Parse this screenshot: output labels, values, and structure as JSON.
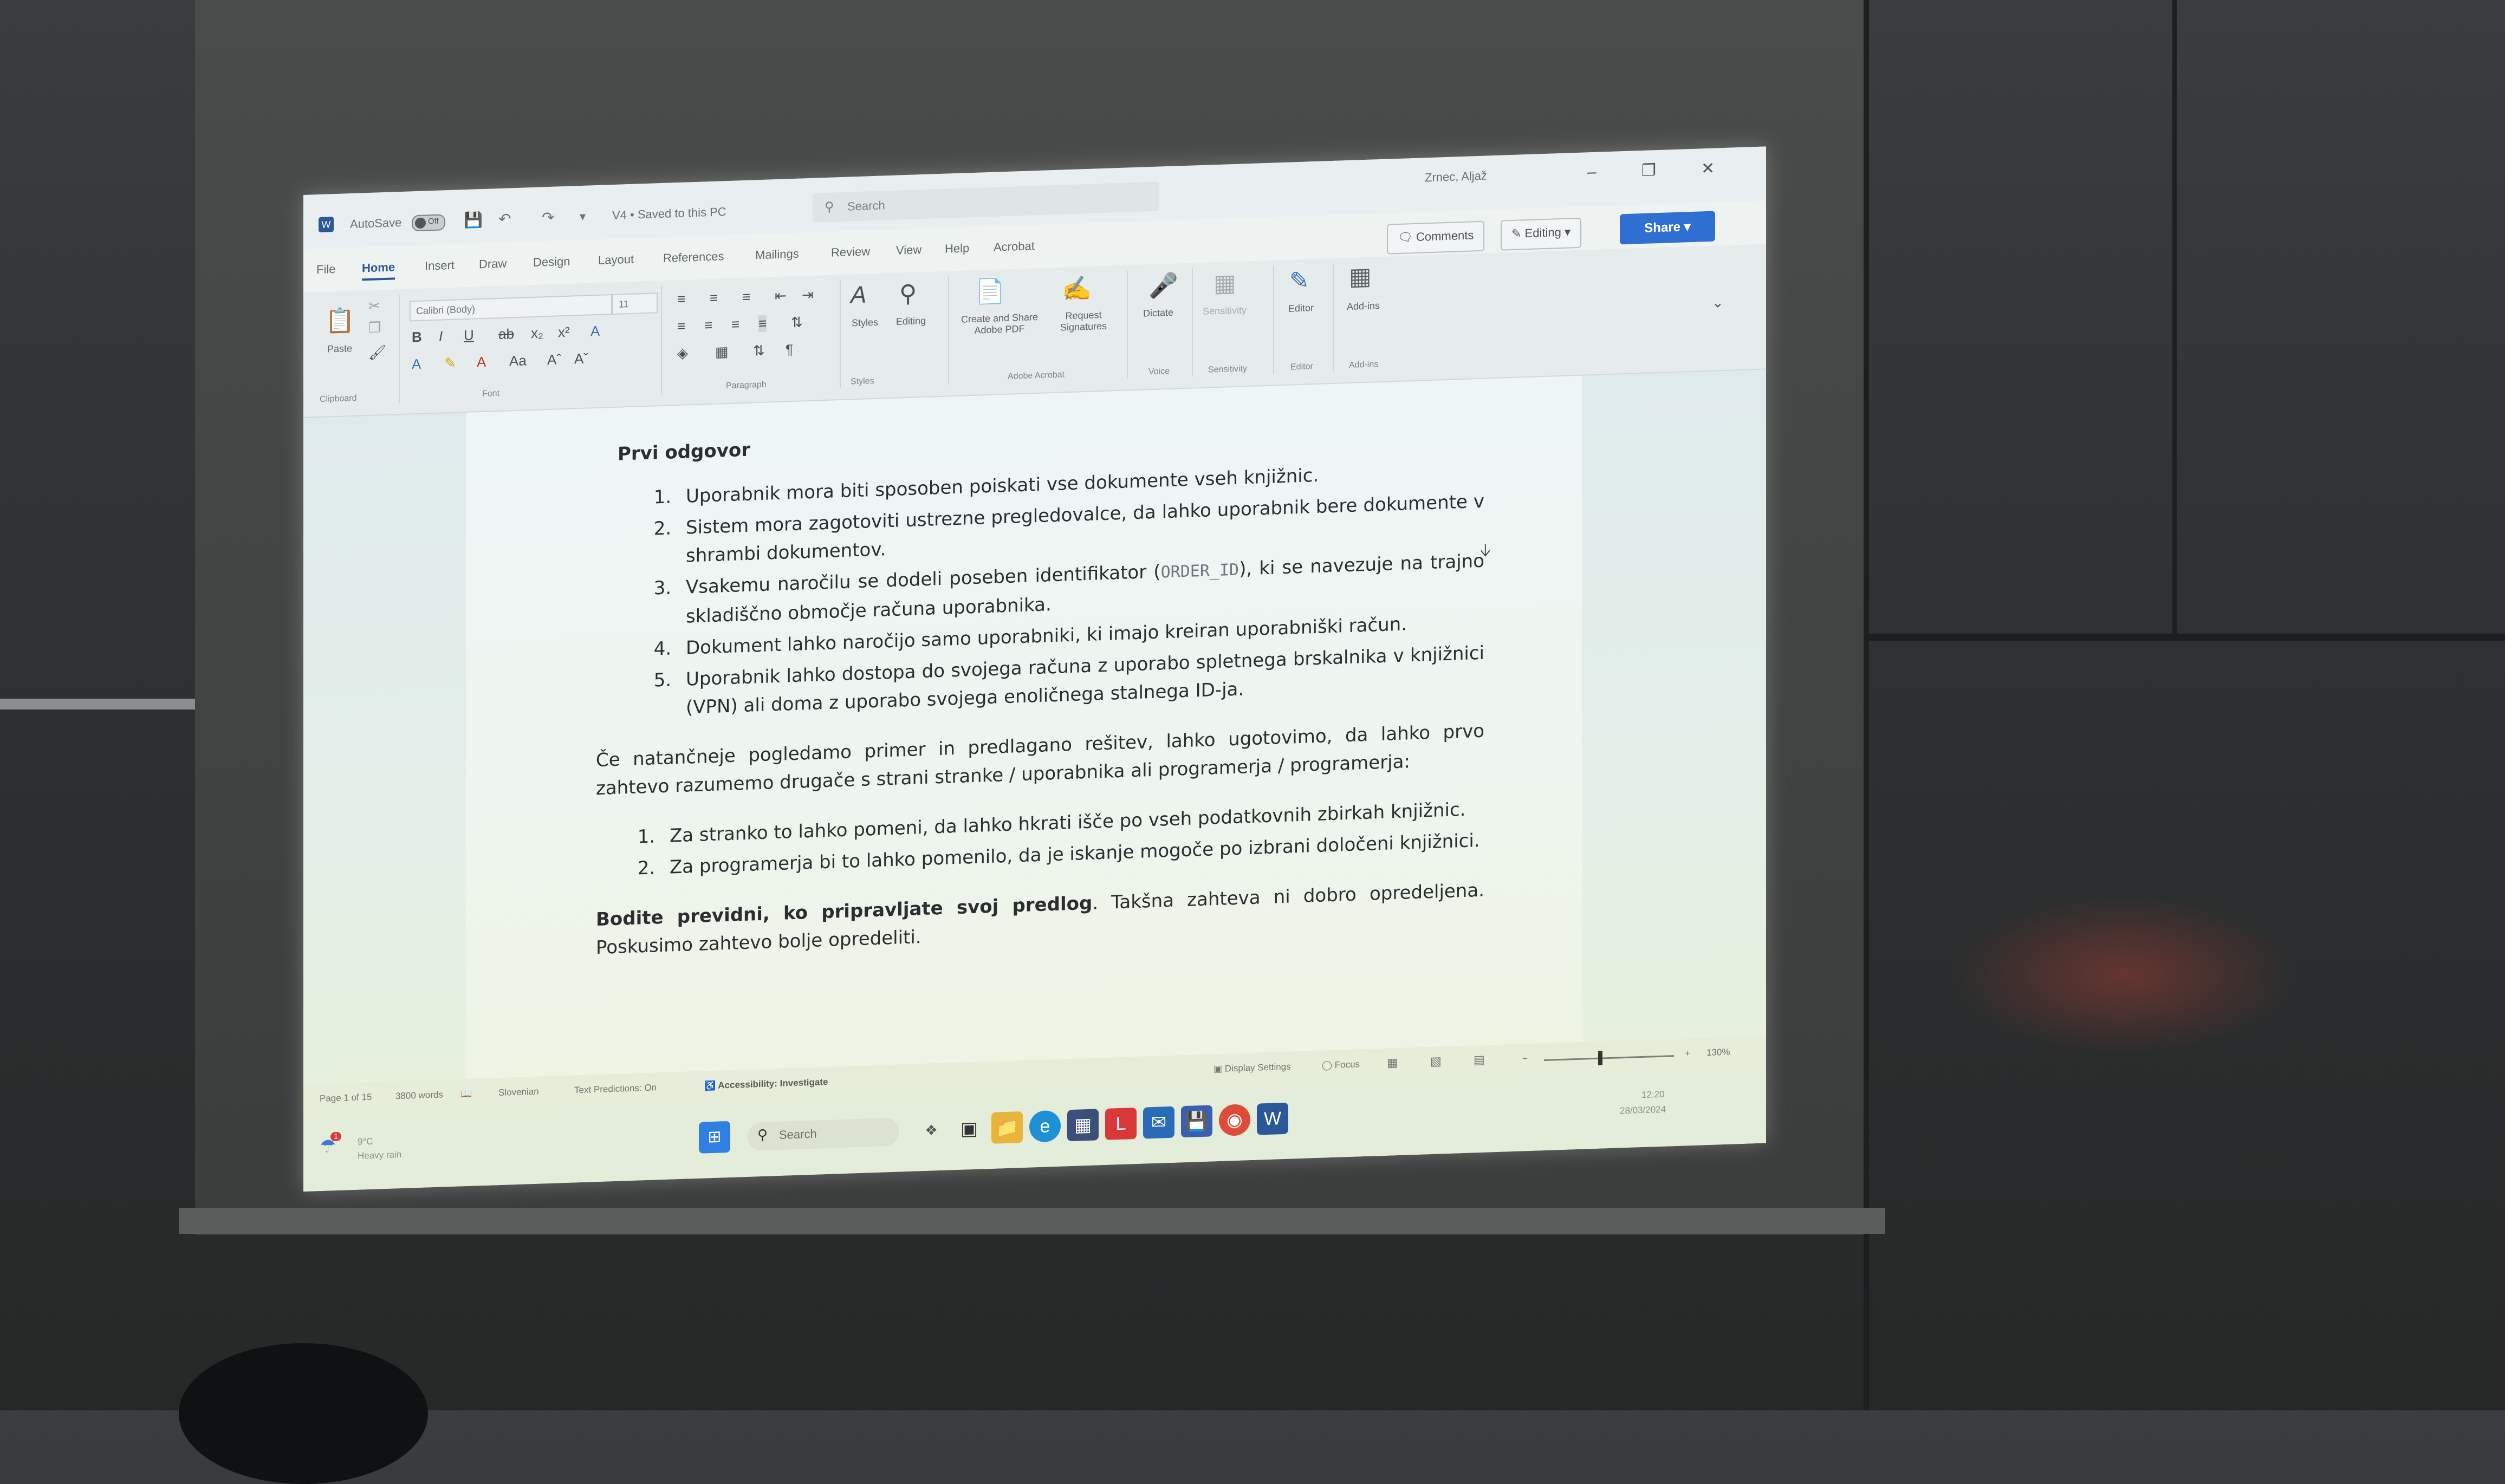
{
  "window": {
    "autosave_label": "AutoSave",
    "autosave_state": "Off",
    "doc_status": "V4 • Saved to this PC",
    "search_placeholder": "Search",
    "user_name": "Zrnec, Aljaž",
    "comments_label": "Comments",
    "editing_label": "Editing",
    "share_label": "Share"
  },
  "tabs": [
    "File",
    "Home",
    "Insert",
    "Draw",
    "Design",
    "Layout",
    "References",
    "Mailings",
    "Review",
    "View",
    "Help",
    "Acrobat"
  ],
  "ribbon": {
    "clipboard": {
      "paste": "Paste",
      "group": "Clipboard"
    },
    "font": {
      "name": "Calibri (Body)",
      "size": "11",
      "group": "Font"
    },
    "paragraph": {
      "group": "Paragraph"
    },
    "styles": {
      "label": "Styles",
      "group": "Styles"
    },
    "editing": {
      "label": "Editing"
    },
    "acrobat": {
      "create_share": "Create and Share Adobe PDF",
      "request_signatures": "Request Signatures",
      "group": "Adobe Acrobat"
    },
    "voice": {
      "dictate": "Dictate",
      "group": "Voice"
    },
    "sensitivity": {
      "label": "Sensitivity",
      "group": "Sensitivity"
    },
    "editor": {
      "label": "Editor",
      "group": "Editor"
    },
    "addins": {
      "label": "Add-ins",
      "group": "Add-ins"
    }
  },
  "document": {
    "heading": "Prvi odgovor",
    "list1": [
      "Uporabnik mora biti sposoben poiskati vse dokumente vseh knjižnic.",
      "Sistem mora zagotoviti ustrezne pregledovalce, da lahko uporabnik bere dokumente v shrambi dokumentov.",
      "Vsakemu naročilu se dodeli poseben identifikator (",
      "Dokument lahko naročijo samo uporabniki, ki imajo kreiran uporabniški račun.",
      "Uporabnik lahko dostopa do svojega računa z uporabo spletnega brskalnika v knjižnici (VPN) ali doma z uporabo svojega enoličnega stalnega ID-ja."
    ],
    "item3_code": "ORDER_ID",
    "item3_tail": "), ki se navezuje na trajno skladiščno območje računa uporabnika.",
    "paragraph1": "Če natančneje pogledamo primer in predlagano rešitev, lahko ugotovimo, da lahko prvo zahtevo razumemo drugače s strani stranke / uporabnika ali programerja / programerja:",
    "list2": [
      "Za stranko to lahko pomeni, da lahko hkrati išče po vseh podatkovnih zbirkah knjižnic.",
      "Za programerja bi to lahko pomenilo, da je iskanje mogoče po izbrani določeni knjižnici."
    ],
    "closing_bold": "Bodite previdni, ko pripravljate svoj predlog",
    "closing_rest": ". Takšna zahteva ni dobro opredeljena. Poskusimo zahtevo bolje opredeliti."
  },
  "statusbar": {
    "page": "Page 1 of 15",
    "words": "3800 words",
    "language": "Slovenian",
    "text_predictions": "Text Predictions: On",
    "accessibility": "Accessibility: Investigate",
    "display_settings": "Display Settings",
    "focus": "Focus",
    "zoom": "130%"
  },
  "taskbar": {
    "weather_temp": "9°C",
    "weather_desc": "Heavy rain",
    "notification_count": "1",
    "search_placeholder": "Search",
    "time": "12:20",
    "date": "28/03/2024"
  },
  "colors": {
    "accent": "#2b579a",
    "share": "#2f6fd1",
    "app_icon_red": "#d9383a"
  }
}
